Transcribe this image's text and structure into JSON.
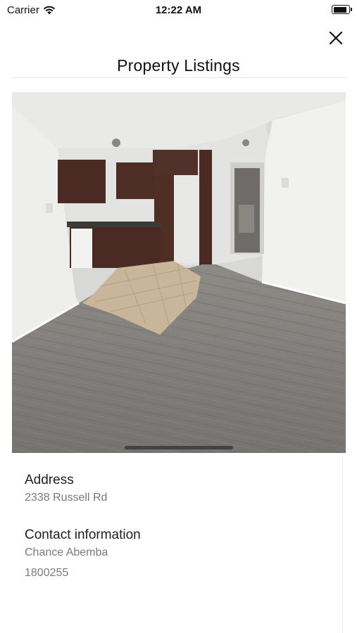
{
  "status_bar": {
    "carrier": "Carrier",
    "time": "12:22 AM",
    "battery_level": 0.9,
    "icons": [
      "wifi-icon",
      "battery-icon"
    ]
  },
  "header": {
    "title": "Property Listings",
    "close_icon": "close-icon"
  },
  "listing": {
    "address_label": "Address",
    "address": "2338 Russell Rd",
    "contact_label": "Contact information",
    "contact_name": "Chance Abemba",
    "contact_phone": "1800255"
  },
  "colors": {
    "background": "#ffffff",
    "label_text": "#1f1f1f",
    "value_text": "#7a7a7a"
  }
}
